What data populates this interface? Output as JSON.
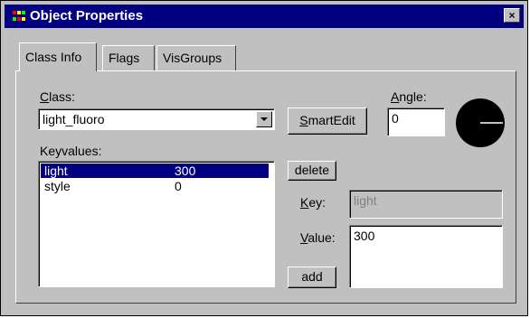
{
  "window": {
    "title": "Object Properties",
    "close_label": "×"
  },
  "tabs": [
    {
      "label": "Class Info",
      "active": true
    },
    {
      "label": "Flags",
      "active": false
    },
    {
      "label": "VisGroups",
      "active": false
    }
  ],
  "class_info": {
    "class_label_u": "C",
    "class_label_rest": "lass:",
    "class_value": "light_fluoro",
    "smartedit_u": "S",
    "smartedit_rest": "martEdit",
    "angle_label_u": "A",
    "angle_label_rest": "ngle:",
    "angle_value": "0",
    "keyvalues_label": "Keyvalues:",
    "keyvalues": [
      {
        "key": "light",
        "value": "300",
        "selected": true
      },
      {
        "key": "style",
        "value": "0",
        "selected": false
      }
    ],
    "delete_label": "delete",
    "key_label_u": "K",
    "key_label_rest": "ey:",
    "key_value": "light",
    "value_label_u": "V",
    "value_label_rest": "alue:",
    "value_value": "300",
    "add_label": "add"
  },
  "colors": {
    "titlebar": "#000080",
    "face": "#c0c0c0",
    "selection": "#000080"
  }
}
